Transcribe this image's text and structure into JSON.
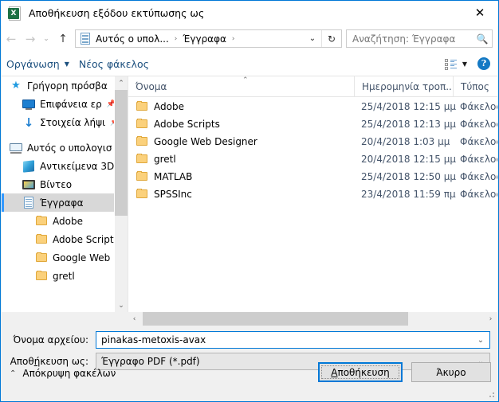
{
  "window": {
    "title": "Αποθήκευση εξόδου εκτύπωσης ως",
    "app_icon": "excel-document-icon",
    "close_label": "✕",
    "accent_color": "#0078d7"
  },
  "nav": {
    "back_label": "←",
    "forward_label": "→",
    "recent_label": "⌄",
    "up_label": "↑",
    "address": {
      "icon": "documents-folder-icon",
      "crumbs": [
        "Αυτός ο υπολ...",
        "Έγγραφα"
      ],
      "separator": "›",
      "dropdown_label": "⌄",
      "refresh_label": "↻"
    },
    "search": {
      "placeholder": "Αναζήτηση: Έγγραφα",
      "icon": "search-icon"
    }
  },
  "commandbar": {
    "organize_label": "Οργάνωση",
    "organize_caret": "▼",
    "new_folder_label": "Νέος φάκελος",
    "view_caret": "▼",
    "view_icon": "view-layout-icon",
    "help_label": "?"
  },
  "sidebar": {
    "scroll": {
      "up_label": "⌃",
      "down_label": "⌄"
    },
    "items": [
      {
        "label": "Γρήγορη πρόσβα",
        "icon": "quick-access-star-icon",
        "indent": 0,
        "pinned": false,
        "selected": false
      },
      {
        "label": "Επιφάνεια ερ",
        "icon": "desktop-icon",
        "indent": 1,
        "pinned": true,
        "selected": false
      },
      {
        "label": "Στοιχεία λήψι",
        "icon": "downloads-icon",
        "indent": 1,
        "pinned": true,
        "selected": false
      },
      {
        "label": "",
        "icon": "spacer",
        "indent": 0,
        "pinned": false,
        "selected": false
      },
      {
        "label": "Αυτός ο υπολογισ",
        "icon": "this-pc-icon",
        "indent": 0,
        "pinned": false,
        "selected": false
      },
      {
        "label": "Αντικείμενα 3D",
        "icon": "3d-objects-icon",
        "indent": 1,
        "pinned": false,
        "selected": false
      },
      {
        "label": "Βίντεο",
        "icon": "videos-icon",
        "indent": 1,
        "pinned": false,
        "selected": false
      },
      {
        "label": "Έγγραφα",
        "icon": "documents-icon",
        "indent": 1,
        "pinned": false,
        "selected": true
      },
      {
        "label": "Adobe",
        "icon": "folder-icon",
        "indent": 2,
        "pinned": false,
        "selected": false
      },
      {
        "label": "Adobe Scripts",
        "icon": "folder-icon",
        "indent": 2,
        "pinned": false,
        "selected": false
      },
      {
        "label": "Google Web De",
        "icon": "folder-icon",
        "indent": 2,
        "pinned": false,
        "selected": false
      },
      {
        "label": "gretl",
        "icon": "folder-icon",
        "indent": 2,
        "pinned": false,
        "selected": false
      }
    ]
  },
  "filelist": {
    "columns": {
      "name": "Όνομα",
      "date": "Ημερομηνία τροπ...",
      "type": "Τύπος"
    },
    "sort_indicator": "⌃",
    "rows": [
      {
        "name": "Adobe",
        "date": "25/4/2018 12:15 μμ",
        "type": "Φάκελος αρχ",
        "icon": "folder-icon"
      },
      {
        "name": "Adobe Scripts",
        "date": "25/4/2018 12:13 μμ",
        "type": "Φάκελος αρχ",
        "icon": "folder-icon"
      },
      {
        "name": "Google Web Designer",
        "date": "20/4/2018 1:03 μμ",
        "type": "Φάκελος αρχ",
        "icon": "folder-icon"
      },
      {
        "name": "gretl",
        "date": "20/4/2018 12:15 μμ",
        "type": "Φάκελος αρχ",
        "icon": "folder-icon"
      },
      {
        "name": "MATLAB",
        "date": "25/4/2018 12:50 μμ",
        "type": "Φάκελος αρχ",
        "icon": "folder-icon"
      },
      {
        "name": "SPSSInc",
        "date": "23/4/2018 11:59 πμ",
        "type": "Φάκελος αρχ",
        "icon": "folder-icon"
      }
    ],
    "hscroll": {
      "left_label": "‹",
      "right_label": "›"
    }
  },
  "form": {
    "filename_label": "Όνομα αρχείου:",
    "filename_value": "pinakas-metoxis-avax",
    "filename_caret": "⌄",
    "filetype_label_pre": "Αποθ",
    "filetype_label_accel": "ή",
    "filetype_label_post": "κευση ως:",
    "filetype_value": "Έγγραφο PDF (*.pdf)",
    "filetype_caret": "⌄",
    "hide_folders_label": "Απόκρυψη φακέλων",
    "hide_folders_chevron": "⌃",
    "save_accel": "Α",
    "save_rest": "ποθήκευση",
    "cancel_label": "Άκυρο"
  }
}
